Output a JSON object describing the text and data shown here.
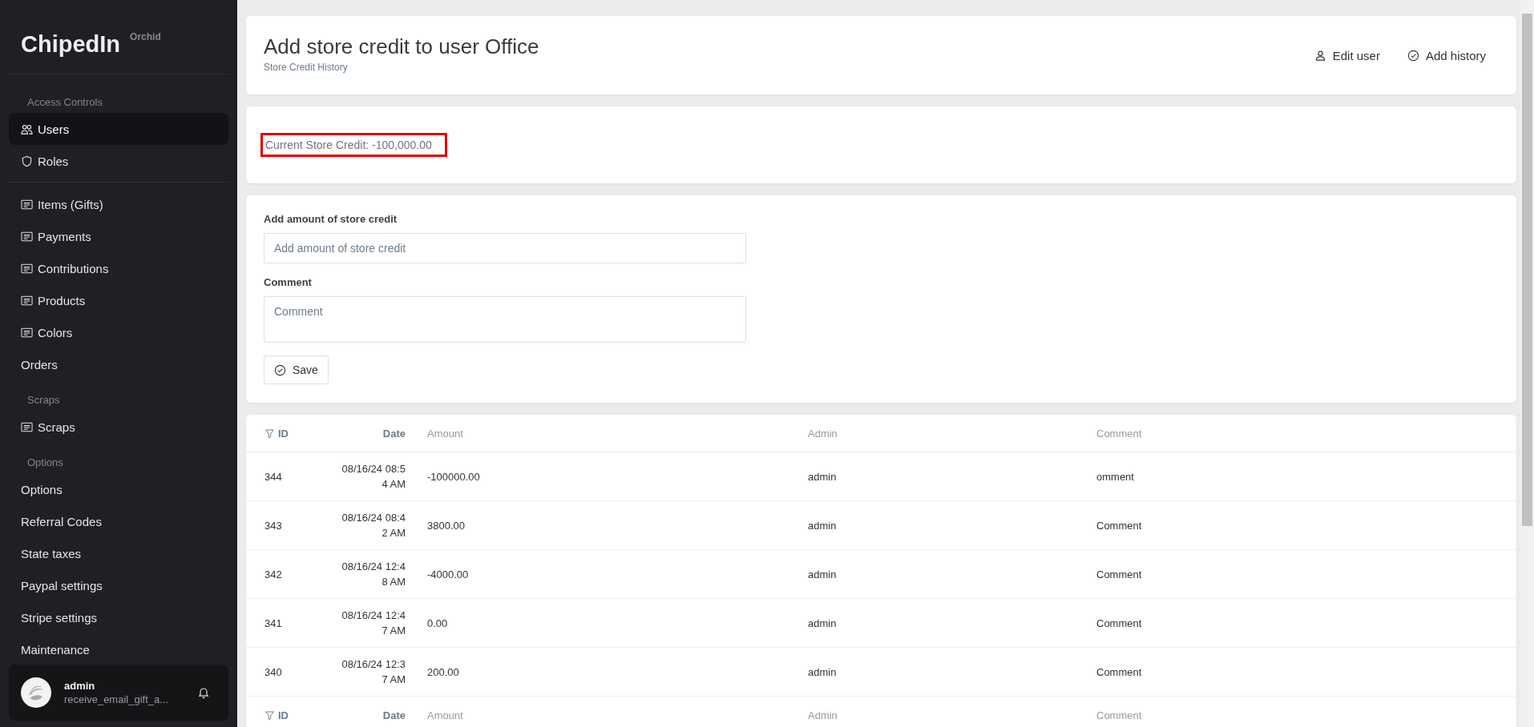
{
  "brand": {
    "name": "ChipedIn",
    "tag": "Orchid"
  },
  "sidebar": {
    "groups": [
      {
        "label": "Access Controls",
        "items": [
          {
            "label": "Users",
            "kind": "users",
            "selected": true
          },
          {
            "label": "Roles",
            "kind": "shield",
            "selected": false
          }
        ]
      },
      {
        "items": [
          {
            "label": "Items (Gifts)",
            "kind": "list",
            "selected": false
          },
          {
            "label": "Payments",
            "kind": "list",
            "selected": false
          },
          {
            "label": "Contributions",
            "kind": "list",
            "selected": false
          },
          {
            "label": "Products",
            "kind": "list",
            "selected": false
          },
          {
            "label": "Colors",
            "kind": "list",
            "selected": false
          },
          {
            "label": "Orders",
            "kind": "plain",
            "selected": false
          }
        ]
      },
      {
        "label": "Scraps",
        "items": [
          {
            "label": "Scraps",
            "kind": "list",
            "selected": false
          }
        ]
      },
      {
        "label": "Options",
        "items": [
          {
            "label": "Options",
            "kind": "plain",
            "selected": false
          },
          {
            "label": "Referral Codes",
            "kind": "plain",
            "selected": false
          },
          {
            "label": "State taxes",
            "kind": "plain",
            "selected": false
          },
          {
            "label": "Paypal settings",
            "kind": "plain",
            "selected": false
          },
          {
            "label": "Stripe settings",
            "kind": "plain",
            "selected": false
          },
          {
            "label": "Maintenance",
            "kind": "plain",
            "selected": false
          }
        ]
      }
    ],
    "user": {
      "name": "admin",
      "detail": "receive_email_gift_a..."
    }
  },
  "header": {
    "title": "Add store credit to user Office",
    "subtitle": "Store Credit History",
    "actions": [
      {
        "label": "Edit user",
        "kind": "user"
      },
      {
        "label": "Add history",
        "kind": "check"
      }
    ]
  },
  "credit": {
    "text": "Current Store Credit: -100,000.00",
    "highlighted": true
  },
  "form": {
    "fields": [
      {
        "label": "Add amount of store credit",
        "placeholder": "Add amount of store credit",
        "kind": "input"
      },
      {
        "label": "Comment",
        "placeholder": "Comment",
        "kind": "textarea"
      }
    ],
    "button": "Save"
  },
  "table": {
    "columns": [
      {
        "label": "ID",
        "filter": true
      },
      {
        "label": "Date",
        "filter": false
      },
      {
        "label": "Amount",
        "filter": false
      },
      {
        "label": "Admin",
        "filter": false
      },
      {
        "label": "Comment",
        "filter": false
      }
    ],
    "rows": [
      [
        "344",
        "08/16/24 08:54 AM",
        "-100000.00",
        "admin",
        "omment"
      ],
      [
        "343",
        "08/16/24 08:42 AM",
        "3800.00",
        "admin",
        "Comment"
      ],
      [
        "342",
        "08/16/24 12:48 AM",
        "-4000.00",
        "admin",
        "Comment"
      ],
      [
        "341",
        "08/16/24 12:47 AM",
        "0.00",
        "admin",
        "Comment"
      ],
      [
        "340",
        "08/16/24 12:37 AM",
        "200.00",
        "admin",
        "Comment"
      ]
    ],
    "footer_columns": [
      {
        "label": "ID",
        "filter": true
      },
      {
        "label": "Date",
        "filter": false
      },
      {
        "label": "Amount",
        "filter": false
      },
      {
        "label": "Admin",
        "filter": false
      },
      {
        "label": "Comment",
        "filter": false
      }
    ]
  }
}
